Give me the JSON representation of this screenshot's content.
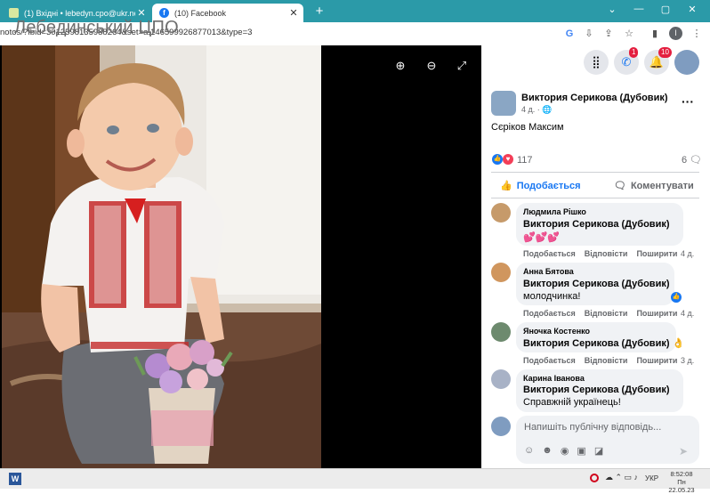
{
  "browser": {
    "tabs": [
      {
        "label": "(1) Вхідні • lebedyn.cpo@ukr.net",
        "active": false
      },
      {
        "label": "(10) Facebook",
        "active": true
      }
    ],
    "new_tab": "+",
    "window_controls": {
      "minimize": "—",
      "maximize": "▢",
      "close": "✕"
    },
    "url": "notos/?fbid=3012598135988264&set=a.146599926877013&type=3",
    "profile_initial": "l"
  },
  "overlay_text": "Лебединський ЦПО",
  "viewer": {
    "zoom_in": "zoom-in",
    "zoom_out": "zoom-out",
    "fullscreen": "fullscreen"
  },
  "header": {
    "messenger_badge": "1",
    "notifications_badge": "10"
  },
  "post": {
    "author": "Виктория Серикова (Дубовик)",
    "time": "4 д.",
    "text": "Сєріков Максим",
    "reactions_count": "117",
    "comments_count": "6",
    "like_label": "Подобається",
    "comment_label": "Коментувати"
  },
  "comments": [
    {
      "author": "Людмила Рішко",
      "tag": "Виктория Серикова (Дубовик)",
      "text": "💕💕💕",
      "age": "4 д."
    },
    {
      "author": "Анна Бятова",
      "tag": "Виктория Серикова (Дубовик)",
      "text": "молодчинка!",
      "age": "4 д."
    },
    {
      "author": "Яночка Костенко",
      "tag": "Виктория Серикова (Дубовик)",
      "text": "👌",
      "age": "3 д."
    },
    {
      "author": "Карина Іванова",
      "tag": "Виктория Серикова (Дубовик)",
      "text": "Справжній українець!",
      "age": ""
    }
  ],
  "comment_actions": {
    "like": "Подобається",
    "reply": "Відповісти",
    "share": "Поширити"
  },
  "reply_box": {
    "placeholder": "Напишіть публічну відповідь..."
  },
  "taskbar": {
    "lang": "УКР",
    "time": "8:52:08",
    "date": "Пн 22.05.23"
  }
}
